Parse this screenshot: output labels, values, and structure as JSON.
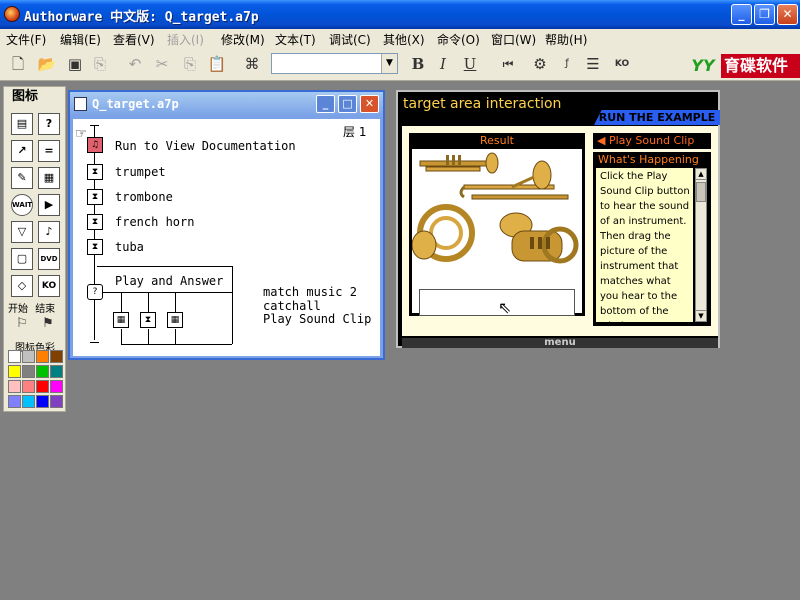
{
  "window": {
    "title": "Authorware 中文版: Q_target.a7p",
    "minimize": "_",
    "restore": "❐",
    "close": "✕"
  },
  "menu": [
    "文件(F)",
    "编辑(E)",
    "查看(V)",
    "插入(I)",
    "修改(M)",
    "文本(T)",
    "调试(C)",
    "其他(X)",
    "命令(O)",
    "窗口(W)",
    "帮助(H)"
  ],
  "toolbar": {
    "bold": "B",
    "italic": "I",
    "underline": "U",
    "style_value": "",
    "logo_yy": "YY",
    "logo_text": "育碟软件"
  },
  "palette": {
    "title": "图标",
    "start_label": "开始",
    "end_label": "结束",
    "color_label": "图标色彩",
    "wait_label": "WAIT",
    "dvd_label": "DVD",
    "ko_label": "KO",
    "swatches": [
      "#ffffff",
      "#c0c0c0",
      "#ff8000",
      "#804000",
      "#ffff00",
      "#808080",
      "#00c000",
      "#008080",
      "#ffc0c0",
      "#ff8080",
      "#ff0000",
      "#ff00ff",
      "#8080ff",
      "#00c0ff",
      "#0000ff",
      "#8040c0"
    ]
  },
  "flowline": {
    "title": "Q_target.a7p",
    "level": "层 1",
    "items": [
      "Run to View Documentation",
      "trumpet",
      "trombone",
      "french horn",
      "tuba"
    ],
    "interaction_label": "Play and Answer",
    "responses": [
      "match music 2",
      "catchall",
      "Play Sound Clip"
    ]
  },
  "presentation": {
    "title": "target area interaction",
    "run_example": "RUN THE EXAMPLE",
    "result_header": "Result",
    "play_button": "Play Sound Clip",
    "whats_header": "What's Happening",
    "whats_text": "Click the Play Sound Clip button to hear the sound of an instrument. Then drag the picture of the instrument that matches what you hear to the bottom of the window.",
    "menu_label": "menu"
  }
}
